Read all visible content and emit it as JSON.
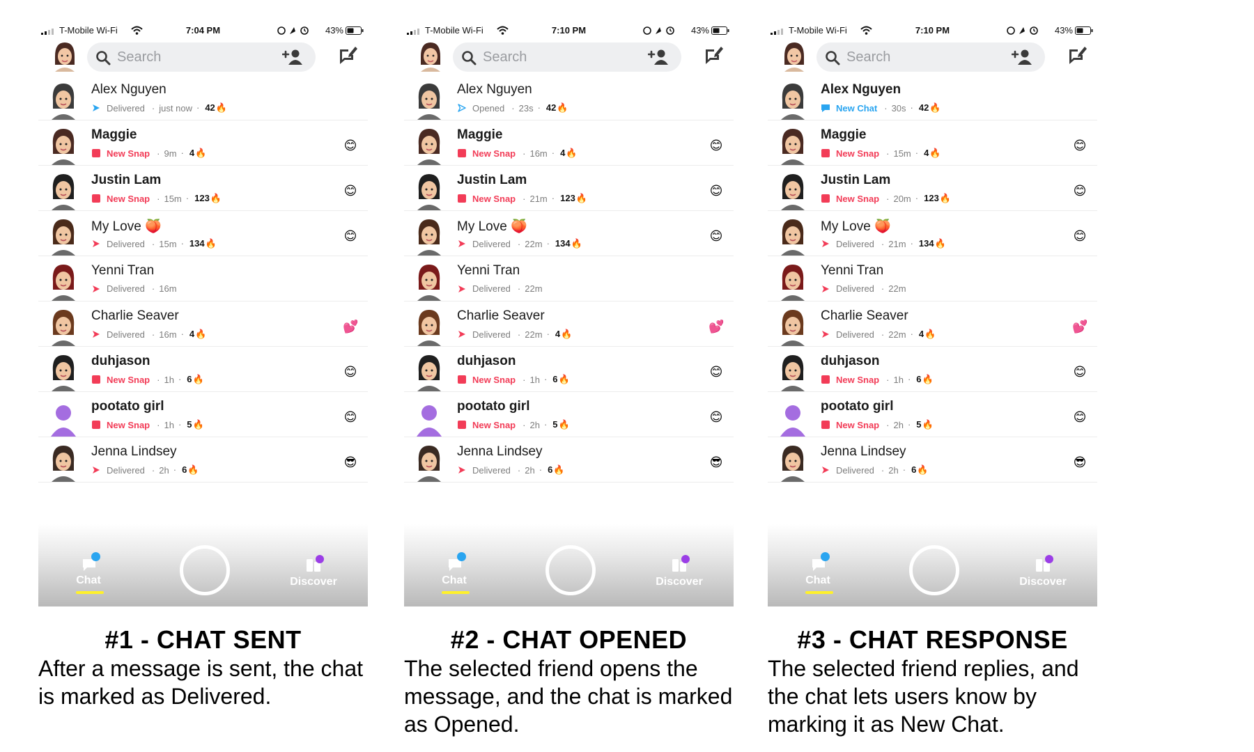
{
  "colors": {
    "snap_red": "#f23c57",
    "chat_blue": "#2aa5f0",
    "delivered_red": "#f23c57",
    "opened_blue": "#2aa5f0",
    "chat_underline": "#fff12a",
    "discover_purple": "#9b3ee6"
  },
  "icons": {
    "search": "search-icon",
    "add_friend": "add-friend-icon",
    "new_chat": "new-chat-icon",
    "delivered": "delivered-arrow-icon",
    "opened": "opened-arrow-outline-icon",
    "snap": "snap-square-icon",
    "chat": "chat-bubble-icon",
    "fire": "🔥"
  },
  "panels": [
    {
      "status": {
        "carrier": "T-Mobile Wi-Fi",
        "time": "7:04 PM",
        "battery": "43%"
      },
      "search_placeholder": "Search",
      "rows": [
        {
          "name": "Alex Nguyen",
          "bold": false,
          "avatar": "#3b3b3b",
          "status_kind": "delivered",
          "status_text": "Delivered",
          "time": "just now",
          "streak": "42",
          "emoji": ""
        },
        {
          "name": "Maggie",
          "bold": true,
          "avatar": "#4a2a22",
          "status_kind": "snap",
          "status_text": "New Snap",
          "time": "9m",
          "streak": "4",
          "emoji": "😊"
        },
        {
          "name": "Justin Lam",
          "bold": true,
          "avatar": "#1f1f1f",
          "status_kind": "snap",
          "status_text": "New Snap",
          "time": "15m",
          "streak": "123",
          "emoji": "😊"
        },
        {
          "name": "My Love 🍑",
          "bold": false,
          "avatar": "#4a2a1a",
          "status_kind": "delivered",
          "status_text": "Delivered",
          "time": "15m",
          "streak": "134",
          "emoji": "😊"
        },
        {
          "name": "Yenni Tran",
          "bold": false,
          "avatar": "#7a1a1a",
          "status_kind": "delivered",
          "status_text": "Delivered",
          "time": "16m",
          "streak": "",
          "emoji": ""
        },
        {
          "name": "Charlie Seaver",
          "bold": false,
          "avatar": "#6b3a1e",
          "status_kind": "delivered",
          "status_text": "Delivered",
          "time": "16m",
          "streak": "4",
          "emoji": "💕"
        },
        {
          "name": "duhjason",
          "bold": true,
          "avatar": "#1f1f1f",
          "status_kind": "snap",
          "status_text": "New Snap",
          "time": "1h",
          "streak": "6",
          "emoji": "😊"
        },
        {
          "name": "pootato girl",
          "bold": true,
          "avatar": "#a46de0",
          "status_kind": "snap",
          "status_text": "New Snap",
          "time": "1h",
          "streak": "5",
          "emoji": "😊"
        },
        {
          "name": "Jenna Lindsey",
          "bold": false,
          "avatar": "#3a2a22",
          "status_kind": "delivered",
          "status_text": "Delivered",
          "time": "2h",
          "streak": "6",
          "emoji": "😎"
        }
      ],
      "nav": {
        "chat": "Chat",
        "discover": "Discover"
      },
      "caption_title": "#1 - CHAT SENT",
      "caption_desc": "After a message is sent, the chat is marked as Delivered."
    },
    {
      "status": {
        "carrier": "T-Mobile Wi-Fi",
        "time": "7:10 PM",
        "battery": "43%"
      },
      "search_placeholder": "Search",
      "rows": [
        {
          "name": "Alex Nguyen",
          "bold": false,
          "avatar": "#3b3b3b",
          "status_kind": "opened",
          "status_text": "Opened",
          "time": "23s",
          "streak": "42",
          "emoji": ""
        },
        {
          "name": "Maggie",
          "bold": true,
          "avatar": "#4a2a22",
          "status_kind": "snap",
          "status_text": "New Snap",
          "time": "16m",
          "streak": "4",
          "emoji": "😊"
        },
        {
          "name": "Justin Lam",
          "bold": true,
          "avatar": "#1f1f1f",
          "status_kind": "snap",
          "status_text": "New Snap",
          "time": "21m",
          "streak": "123",
          "emoji": "😊"
        },
        {
          "name": "My Love 🍑",
          "bold": false,
          "avatar": "#4a2a1a",
          "status_kind": "delivered",
          "status_text": "Delivered",
          "time": "22m",
          "streak": "134",
          "emoji": "😊"
        },
        {
          "name": "Yenni Tran",
          "bold": false,
          "avatar": "#7a1a1a",
          "status_kind": "delivered",
          "status_text": "Delivered",
          "time": "22m",
          "streak": "",
          "emoji": ""
        },
        {
          "name": "Charlie Seaver",
          "bold": false,
          "avatar": "#6b3a1e",
          "status_kind": "delivered",
          "status_text": "Delivered",
          "time": "22m",
          "streak": "4",
          "emoji": "💕"
        },
        {
          "name": "duhjason",
          "bold": true,
          "avatar": "#1f1f1f",
          "status_kind": "snap",
          "status_text": "New Snap",
          "time": "1h",
          "streak": "6",
          "emoji": "😊"
        },
        {
          "name": "pootato girl",
          "bold": true,
          "avatar": "#a46de0",
          "status_kind": "snap",
          "status_text": "New Snap",
          "time": "2h",
          "streak": "5",
          "emoji": "😊"
        },
        {
          "name": "Jenna Lindsey",
          "bold": false,
          "avatar": "#3a2a22",
          "status_kind": "delivered",
          "status_text": "Delivered",
          "time": "2h",
          "streak": "6",
          "emoji": "😎"
        }
      ],
      "nav": {
        "chat": "Chat",
        "discover": "Discover"
      },
      "caption_title": "#2 - CHAT OPENED",
      "caption_desc": "The selected friend opens the message, and the chat is marked as Opened."
    },
    {
      "status": {
        "carrier": "T-Mobile Wi-Fi",
        "time": "7:10 PM",
        "battery": "43%"
      },
      "search_placeholder": "Search",
      "rows": [
        {
          "name": "Alex Nguyen",
          "bold": true,
          "avatar": "#3b3b3b",
          "status_kind": "chat",
          "status_text": "New Chat",
          "time": "30s",
          "streak": "42",
          "emoji": ""
        },
        {
          "name": "Maggie",
          "bold": true,
          "avatar": "#4a2a22",
          "status_kind": "snap",
          "status_text": "New Snap",
          "time": "15m",
          "streak": "4",
          "emoji": "😊"
        },
        {
          "name": "Justin Lam",
          "bold": true,
          "avatar": "#1f1f1f",
          "status_kind": "snap",
          "status_text": "New Snap",
          "time": "20m",
          "streak": "123",
          "emoji": "😊"
        },
        {
          "name": "My Love 🍑",
          "bold": false,
          "avatar": "#4a2a1a",
          "status_kind": "delivered",
          "status_text": "Delivered",
          "time": "21m",
          "streak": "134",
          "emoji": "😊"
        },
        {
          "name": "Yenni Tran",
          "bold": false,
          "avatar": "#7a1a1a",
          "status_kind": "delivered",
          "status_text": "Delivered",
          "time": "22m",
          "streak": "",
          "emoji": ""
        },
        {
          "name": "Charlie Seaver",
          "bold": false,
          "avatar": "#6b3a1e",
          "status_kind": "delivered",
          "status_text": "Delivered",
          "time": "22m",
          "streak": "4",
          "emoji": "💕"
        },
        {
          "name": "duhjason",
          "bold": true,
          "avatar": "#1f1f1f",
          "status_kind": "snap",
          "status_text": "New Snap",
          "time": "1h",
          "streak": "6",
          "emoji": "😊"
        },
        {
          "name": "pootato girl",
          "bold": true,
          "avatar": "#a46de0",
          "status_kind": "snap",
          "status_text": "New Snap",
          "time": "2h",
          "streak": "5",
          "emoji": "😊"
        },
        {
          "name": "Jenna Lindsey",
          "bold": false,
          "avatar": "#3a2a22",
          "status_kind": "delivered",
          "status_text": "Delivered",
          "time": "2h",
          "streak": "6",
          "emoji": "😎"
        }
      ],
      "nav": {
        "chat": "Chat",
        "discover": "Discover"
      },
      "caption_title": "#3 - CHAT RESPONSE",
      "caption_desc": "The selected friend replies, and the chat lets users know by marking it as New Chat."
    }
  ]
}
